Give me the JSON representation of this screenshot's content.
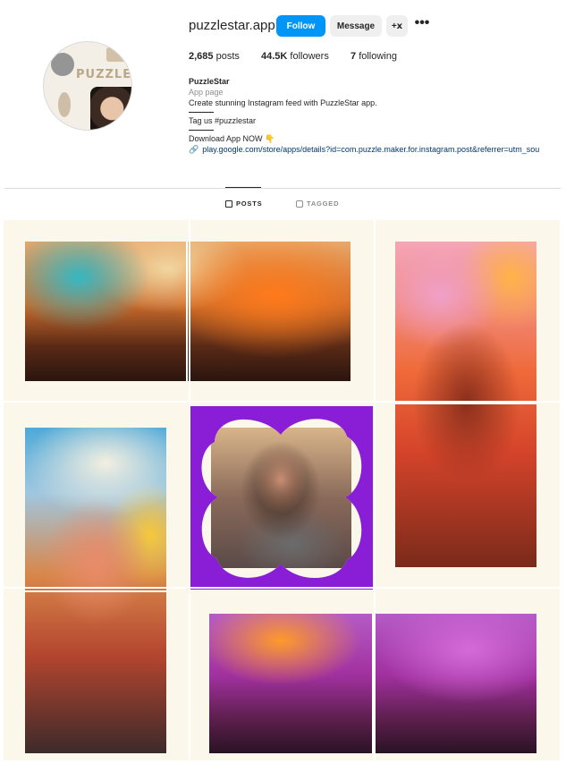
{
  "profile": {
    "username": "puzzlestar.app",
    "follow_label": "Follow",
    "message_label": "Message",
    "suggest_icon": "+ⅹ",
    "more_icon": "•••",
    "avatar_logo": "PUZZLE"
  },
  "stats": {
    "posts_count": "2,685",
    "posts_label": "posts",
    "followers_count": "44.5K",
    "followers_label": "followers",
    "following_count": "7",
    "following_label": "following"
  },
  "bio": {
    "name": "PuzzleStar",
    "category": "App page",
    "description": "Create stunning Instagram feed with PuzzleStar app.",
    "tag_line": "Tag us #puzzlestar",
    "download_line": "Download App NOW 👇",
    "link_icon": "🔗",
    "link": "play.google.com/store/apps/details?id=com.puzzle.maker.for.instagram.post&referrer=utm_sou"
  },
  "tabs": {
    "posts_label": "POSTS",
    "tagged_label": "TAGGED"
  },
  "colors": {
    "follow_button": "#0095f6",
    "frame_purple": "#8a1ed6",
    "grid_background": "#fbf7ea"
  }
}
